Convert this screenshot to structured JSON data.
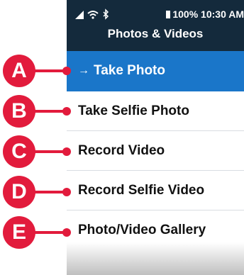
{
  "status_bar": {
    "battery": "100%",
    "time": "10:30 AM",
    "icons": [
      "signal-icon",
      "wifi-icon",
      "bluetooth-icon",
      "battery-icon"
    ]
  },
  "header": {
    "title": "Photos & Videos"
  },
  "menu": {
    "items": [
      {
        "label": "Take Photo",
        "arrow": "→"
      },
      {
        "label": "Take Selfie Photo"
      },
      {
        "label": "Record Video"
      },
      {
        "label": "Record Selfie Video"
      },
      {
        "label": "Photo/Video Gallery"
      }
    ]
  },
  "callouts": [
    "A",
    "B",
    "C",
    "D",
    "E"
  ],
  "colors": {
    "header_bg": "#142a3c",
    "selected_bg": "#1a76c9",
    "callout": "#e21b3c"
  }
}
